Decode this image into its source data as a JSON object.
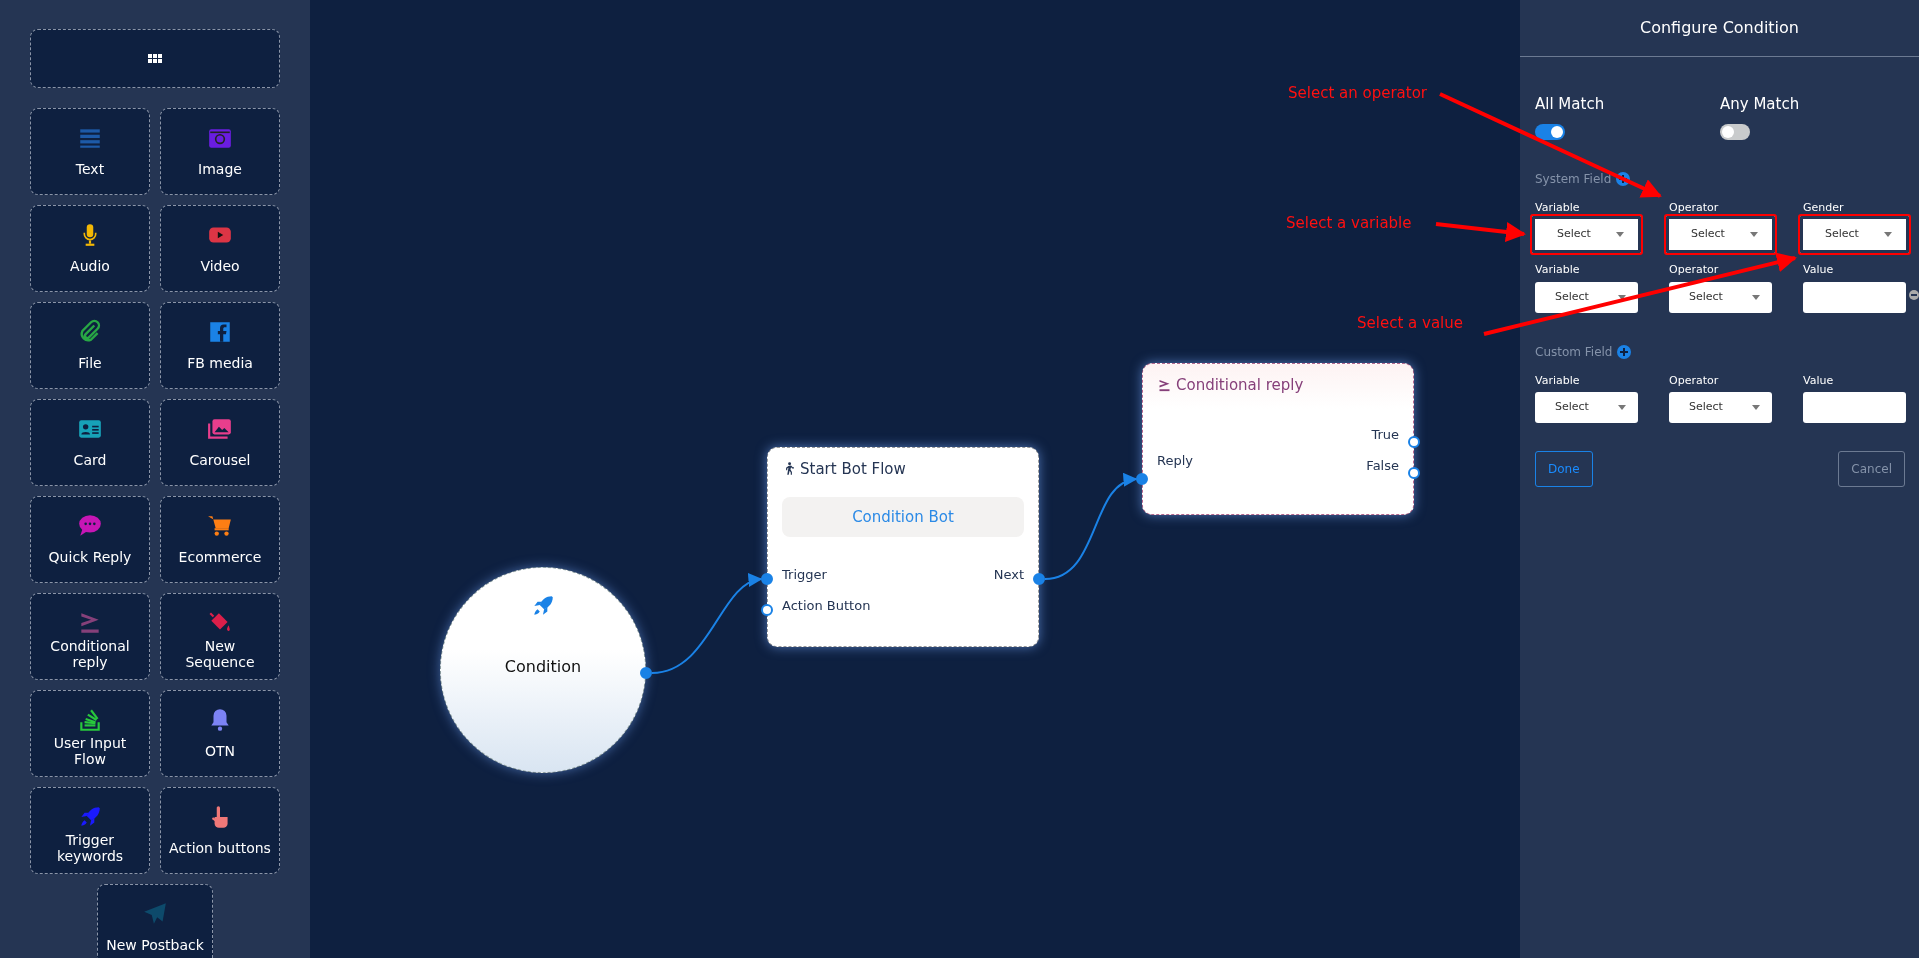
{
  "sidebar": {
    "items": [
      {
        "label": "Text",
        "kind": "text"
      },
      {
        "label": "Image",
        "kind": "image"
      },
      {
        "label": "Audio",
        "kind": "audio"
      },
      {
        "label": "Video",
        "kind": "video"
      },
      {
        "label": "File",
        "kind": "file"
      },
      {
        "label": "FB media",
        "kind": "fbmedia"
      },
      {
        "label": "Card",
        "kind": "card"
      },
      {
        "label": "Carousel",
        "kind": "carousel"
      },
      {
        "label": "Quick Reply",
        "kind": "quickreply"
      },
      {
        "label": "Ecommerce",
        "kind": "ecommerce"
      },
      {
        "label": "Conditional reply",
        "kind": "conditional"
      },
      {
        "label": "New Sequence",
        "kind": "sequence"
      },
      {
        "label": "User Input Flow",
        "kind": "userinput"
      },
      {
        "label": "OTN",
        "kind": "otn"
      },
      {
        "label": "Trigger keywords",
        "kind": "trigger"
      },
      {
        "label": "Action buttons",
        "kind": "action"
      },
      {
        "label": "New Postback",
        "kind": "postback"
      }
    ]
  },
  "canvas": {
    "start_node": {
      "label": "Condition"
    },
    "start_bot_flow": {
      "title": "Start Bot Flow",
      "bot": "Condition Bot",
      "inputs": [
        {
          "label": "Trigger",
          "connected": true
        },
        {
          "label": "Action Button",
          "connected": false
        }
      ],
      "outputs": [
        {
          "label": "Next",
          "connected": true
        }
      ]
    },
    "conditional_reply": {
      "title": "Conditional reply",
      "inputs": [
        {
          "label": "Reply",
          "connected": true
        }
      ],
      "outputs": [
        {
          "label": "True",
          "connected": false
        },
        {
          "label": "False",
          "connected": false
        }
      ]
    }
  },
  "panel": {
    "title": "Configure Condition",
    "match_options": [
      {
        "label": "All Match",
        "on": true
      },
      {
        "label": "Any Match",
        "on": false
      }
    ],
    "sections": [
      {
        "label": "System Field",
        "rows": [
          [
            {
              "label": "Variable",
              "kind": "select",
              "value": "Select",
              "highlighted": true
            },
            {
              "label": "Operator",
              "kind": "select",
              "value": "Select",
              "highlighted": true
            },
            {
              "label": "Gender",
              "kind": "select",
              "value": "Select",
              "highlighted": true
            }
          ],
          [
            {
              "label": "Variable",
              "kind": "select",
              "value": "Select",
              "highlighted": false
            },
            {
              "label": "Operator",
              "kind": "select",
              "value": "Select",
              "highlighted": false
            },
            {
              "label": "Value",
              "kind": "input",
              "highlighted": false,
              "removable": true
            }
          ]
        ]
      },
      {
        "label": "Custom Field",
        "rows": [
          [
            {
              "label": "Variable",
              "kind": "select",
              "value": "Select",
              "highlighted": false
            },
            {
              "label": "Operator",
              "kind": "select",
              "value": "Select",
              "highlighted": false
            },
            {
              "label": "Value",
              "kind": "input",
              "highlighted": false
            }
          ]
        ]
      }
    ],
    "buttons": [
      {
        "label": "Done",
        "kind": "primary"
      },
      {
        "label": "Cancel",
        "kind": "secondary"
      }
    ]
  },
  "annotations": [
    {
      "text": "Select an operator"
    },
    {
      "text": "Select a variable"
    },
    {
      "text": "Select a value"
    }
  ]
}
